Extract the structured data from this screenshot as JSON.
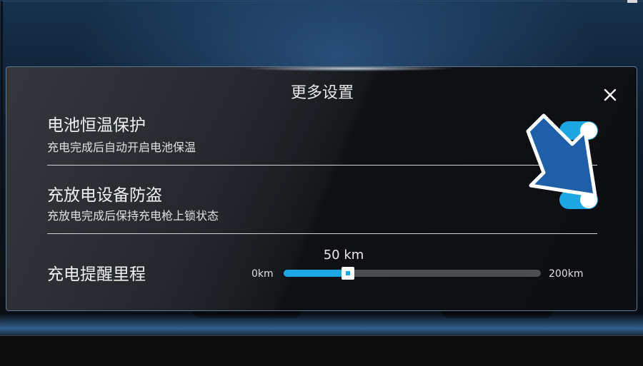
{
  "dialog": {
    "title": "更多设置",
    "close_icon": "close-icon"
  },
  "settings": [
    {
      "title": "电池恒温保护",
      "subtitle": "充电完成后自动开启电池保温",
      "enabled": true
    },
    {
      "title": "充放电设备防盗",
      "subtitle": "充放电完成后保持充电枪上锁状态",
      "enabled": true
    }
  ],
  "reminder": {
    "title": "充电提醒里程",
    "value_label": "50 km",
    "min_label": "0km",
    "max_label": "200km",
    "value": 50,
    "min": 0,
    "max": 200
  },
  "annotation": {
    "icon": "pointer-arrow-icon",
    "color": "#1f5fa8"
  },
  "colors": {
    "accent": "#1da7e2",
    "track": "#4a4d52"
  }
}
